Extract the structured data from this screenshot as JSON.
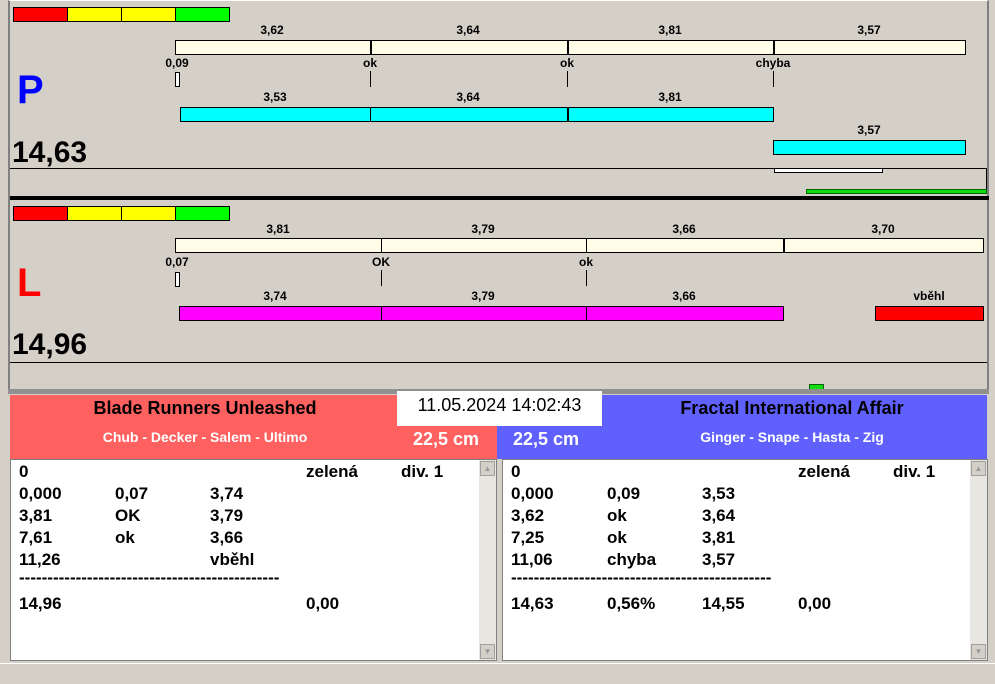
{
  "right_lane": {
    "letter": "P",
    "total": "14,63",
    "top_values": [
      "3,62",
      "3,64",
      "3,81",
      "3,57"
    ],
    "marks": [
      "0,09",
      "ok",
      "ok",
      "chyba"
    ],
    "bottom_values": [
      "3,53",
      "3,64",
      "3,81"
    ],
    "last_value": "3,57"
  },
  "left_lane": {
    "letter": "L",
    "total": "14,96",
    "top_values": [
      "3,81",
      "3,79",
      "3,66",
      "3,70"
    ],
    "marks": [
      "0,07",
      "OK",
      "ok"
    ],
    "bottom_values": [
      "3,74",
      "3,79",
      "3,66"
    ],
    "fault_label": "vběhl"
  },
  "datetime": "11.05.2024 14:02:43",
  "left_team": {
    "name": "Blade Runners Unleashed",
    "members": "Chub - Decker - Salem - Ultimo",
    "length": "22,5 cm",
    "rows": [
      [
        "0",
        "",
        "",
        "zelená",
        "div. 1"
      ],
      [
        "0,000",
        "0,07",
        "3,74",
        "",
        ""
      ],
      [
        "3,81",
        "OK",
        "3,79",
        "",
        ""
      ],
      [
        "7,61",
        "ok",
        "3,66",
        "",
        ""
      ],
      [
        "11,26",
        "",
        "vběhl",
        "",
        ""
      ]
    ],
    "separator": "----------------------------------------------",
    "total_row": [
      "14,96",
      "",
      "",
      "0,00",
      ""
    ]
  },
  "right_team": {
    "name": "Fractal International Affair",
    "members": "Ginger - Snape - Hasta - Zig",
    "length": "22,5 cm",
    "rows": [
      [
        "0",
        "",
        "",
        "zelená",
        "div. 1"
      ],
      [
        "0,000",
        "0,09",
        "3,53",
        "",
        ""
      ],
      [
        "3,62",
        "ok",
        "3,64",
        "",
        ""
      ],
      [
        "7,25",
        "ok",
        "3,81",
        "",
        ""
      ],
      [
        "11,06",
        "chyba",
        "3,57",
        "",
        ""
      ]
    ],
    "separator": "----------------------------------------------",
    "total_row": [
      "14,63",
      "0,56%",
      "14,55",
      "0,00",
      ""
    ]
  },
  "colors": {
    "red": "#ff0000",
    "yellow": "#ffff00",
    "green": "#00ff00",
    "cream": "#fffde8",
    "cyan": "#00ffff",
    "magenta": "#ff00ff",
    "left_header": "#ff6060",
    "right_header": "#6060ff"
  }
}
